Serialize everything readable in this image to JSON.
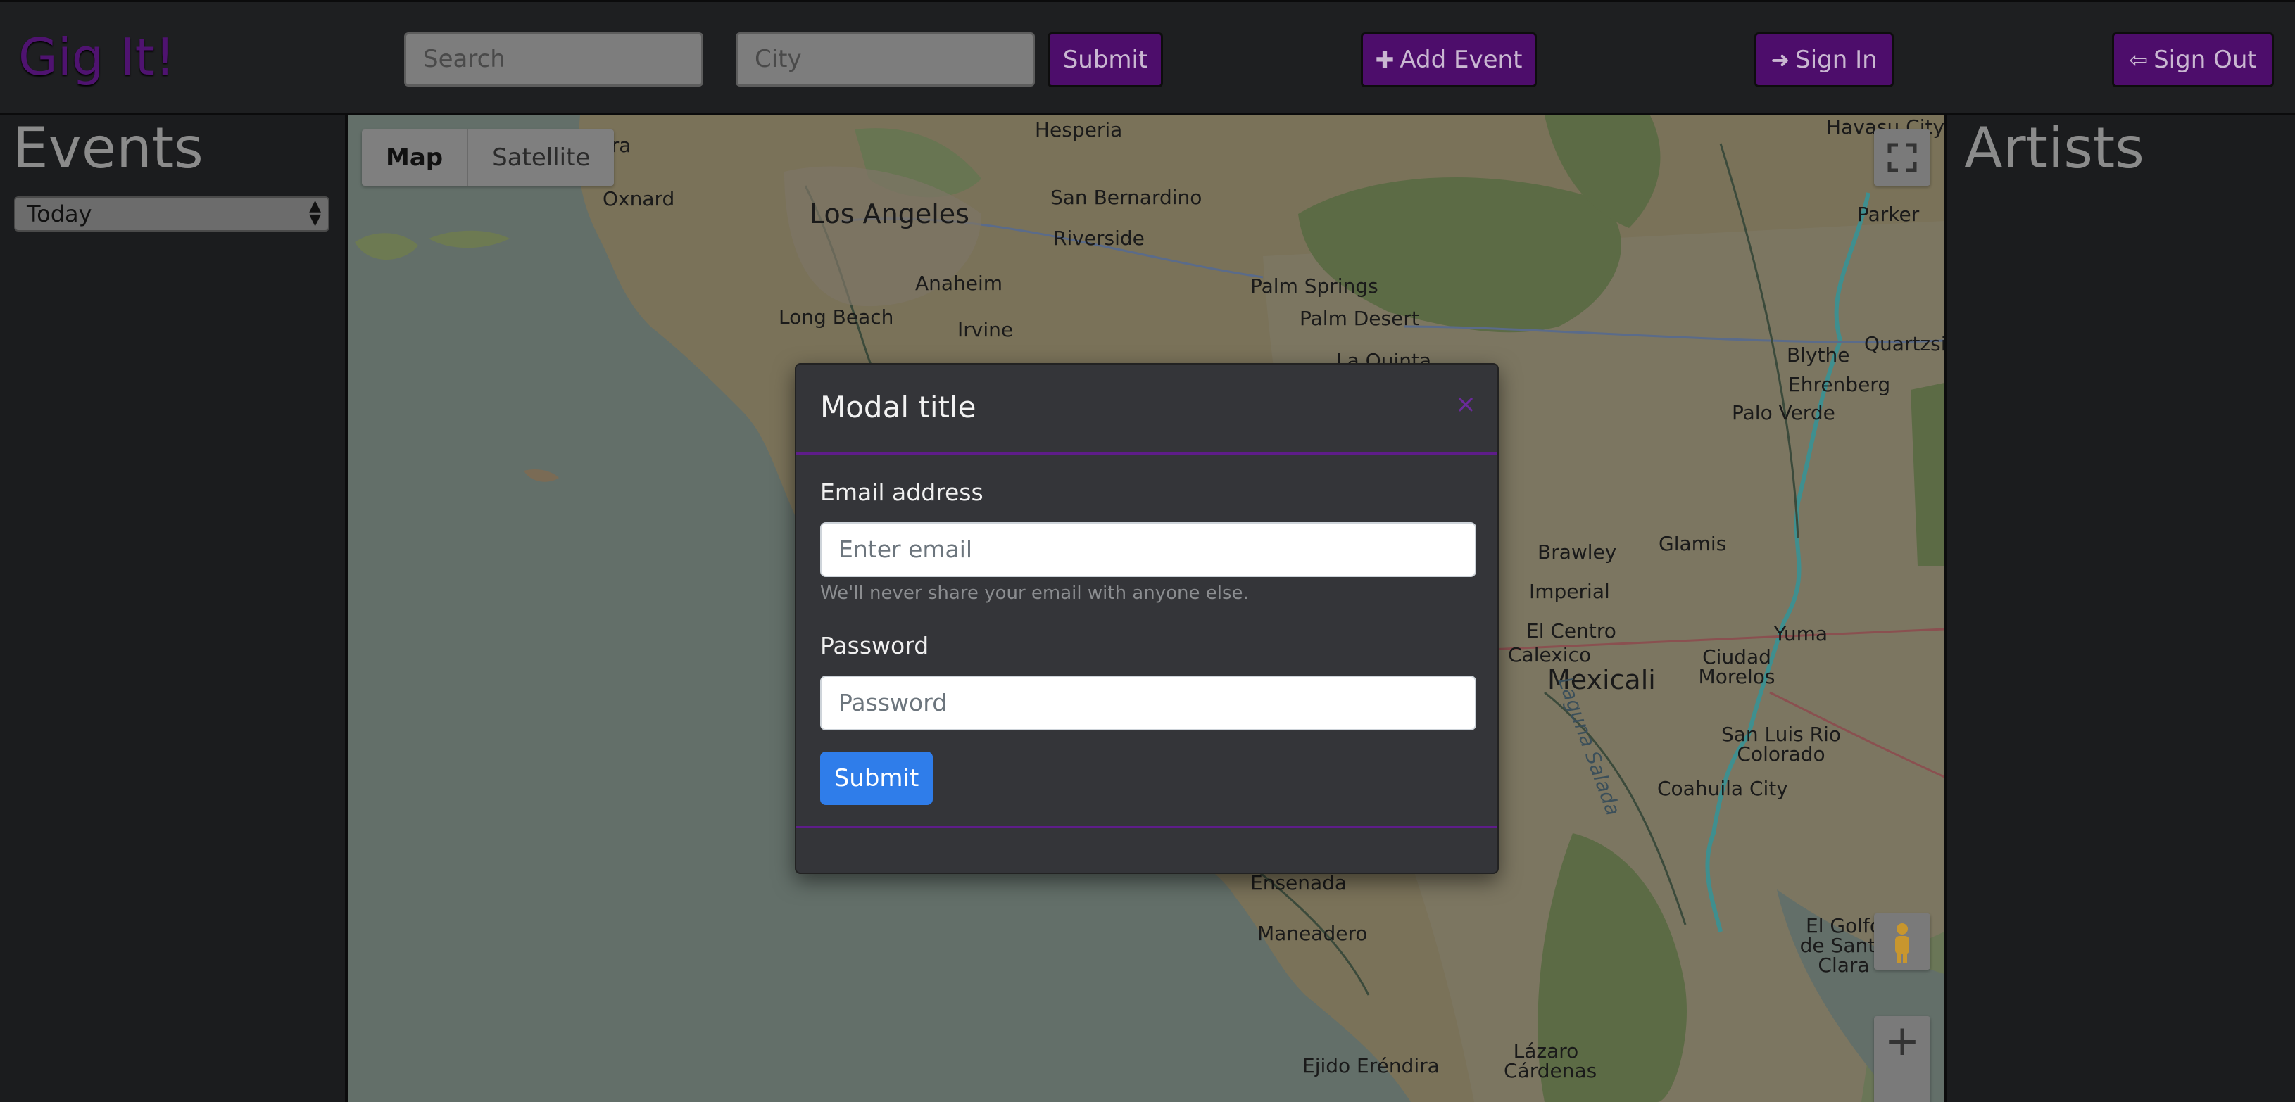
{
  "brand": "Gig It!",
  "nav": {
    "search_placeholder": "Search",
    "city_placeholder": "City",
    "submit_label": "Submit",
    "add_event_label": "Add Event",
    "sign_in_label": "Sign In",
    "sign_out_label": "Sign Out"
  },
  "events": {
    "title": "Events",
    "selected_range": "Today"
  },
  "artists": {
    "title": "Artists"
  },
  "map": {
    "type_map": "Map",
    "type_satellite": "Satellite",
    "labels": {
      "l1": "tura",
      "l2": "Oxnard",
      "l3": "Los Angeles",
      "l4": "Long Beach",
      "l5": "Anaheim",
      "l6": "Irvine",
      "l7": "Hesperia",
      "l8": "San Bernardino",
      "l9": "Riverside",
      "l10": "Palm Springs",
      "l11": "Palm Desert",
      "l12": "Havasu City",
      "l13": "Parker",
      "l14": "Quartzsite",
      "l15": "Blythe",
      "l16": "Ehrenberg",
      "l17": "Palo Verde",
      "l18": "Brawley",
      "l19": "Glamis",
      "l20": "Imperial",
      "l21": "El Centro",
      "l22": "Calexico",
      "l23": "Mexicali",
      "l24": "Yuma",
      "l25": "Ciudad Morelos",
      "l26": "San Luis Rio Colorado",
      "l27": "Coahuila City",
      "l28": "Ensenada",
      "l29": "Maneadero",
      "l30": "El Golfo de Santa Clara",
      "l31": "Ejido Eréndira",
      "l32": "Lázaro Cárdenas",
      "l33": "Laguna Salada",
      "l34": "La Quinta"
    }
  },
  "modal": {
    "title": "Modal title",
    "close": "×",
    "email_label": "Email address",
    "email_placeholder": "Enter email",
    "email_help": "We'll never share your email with anyone else.",
    "password_label": "Password",
    "password_placeholder": "Password",
    "submit_label": "Submit"
  }
}
